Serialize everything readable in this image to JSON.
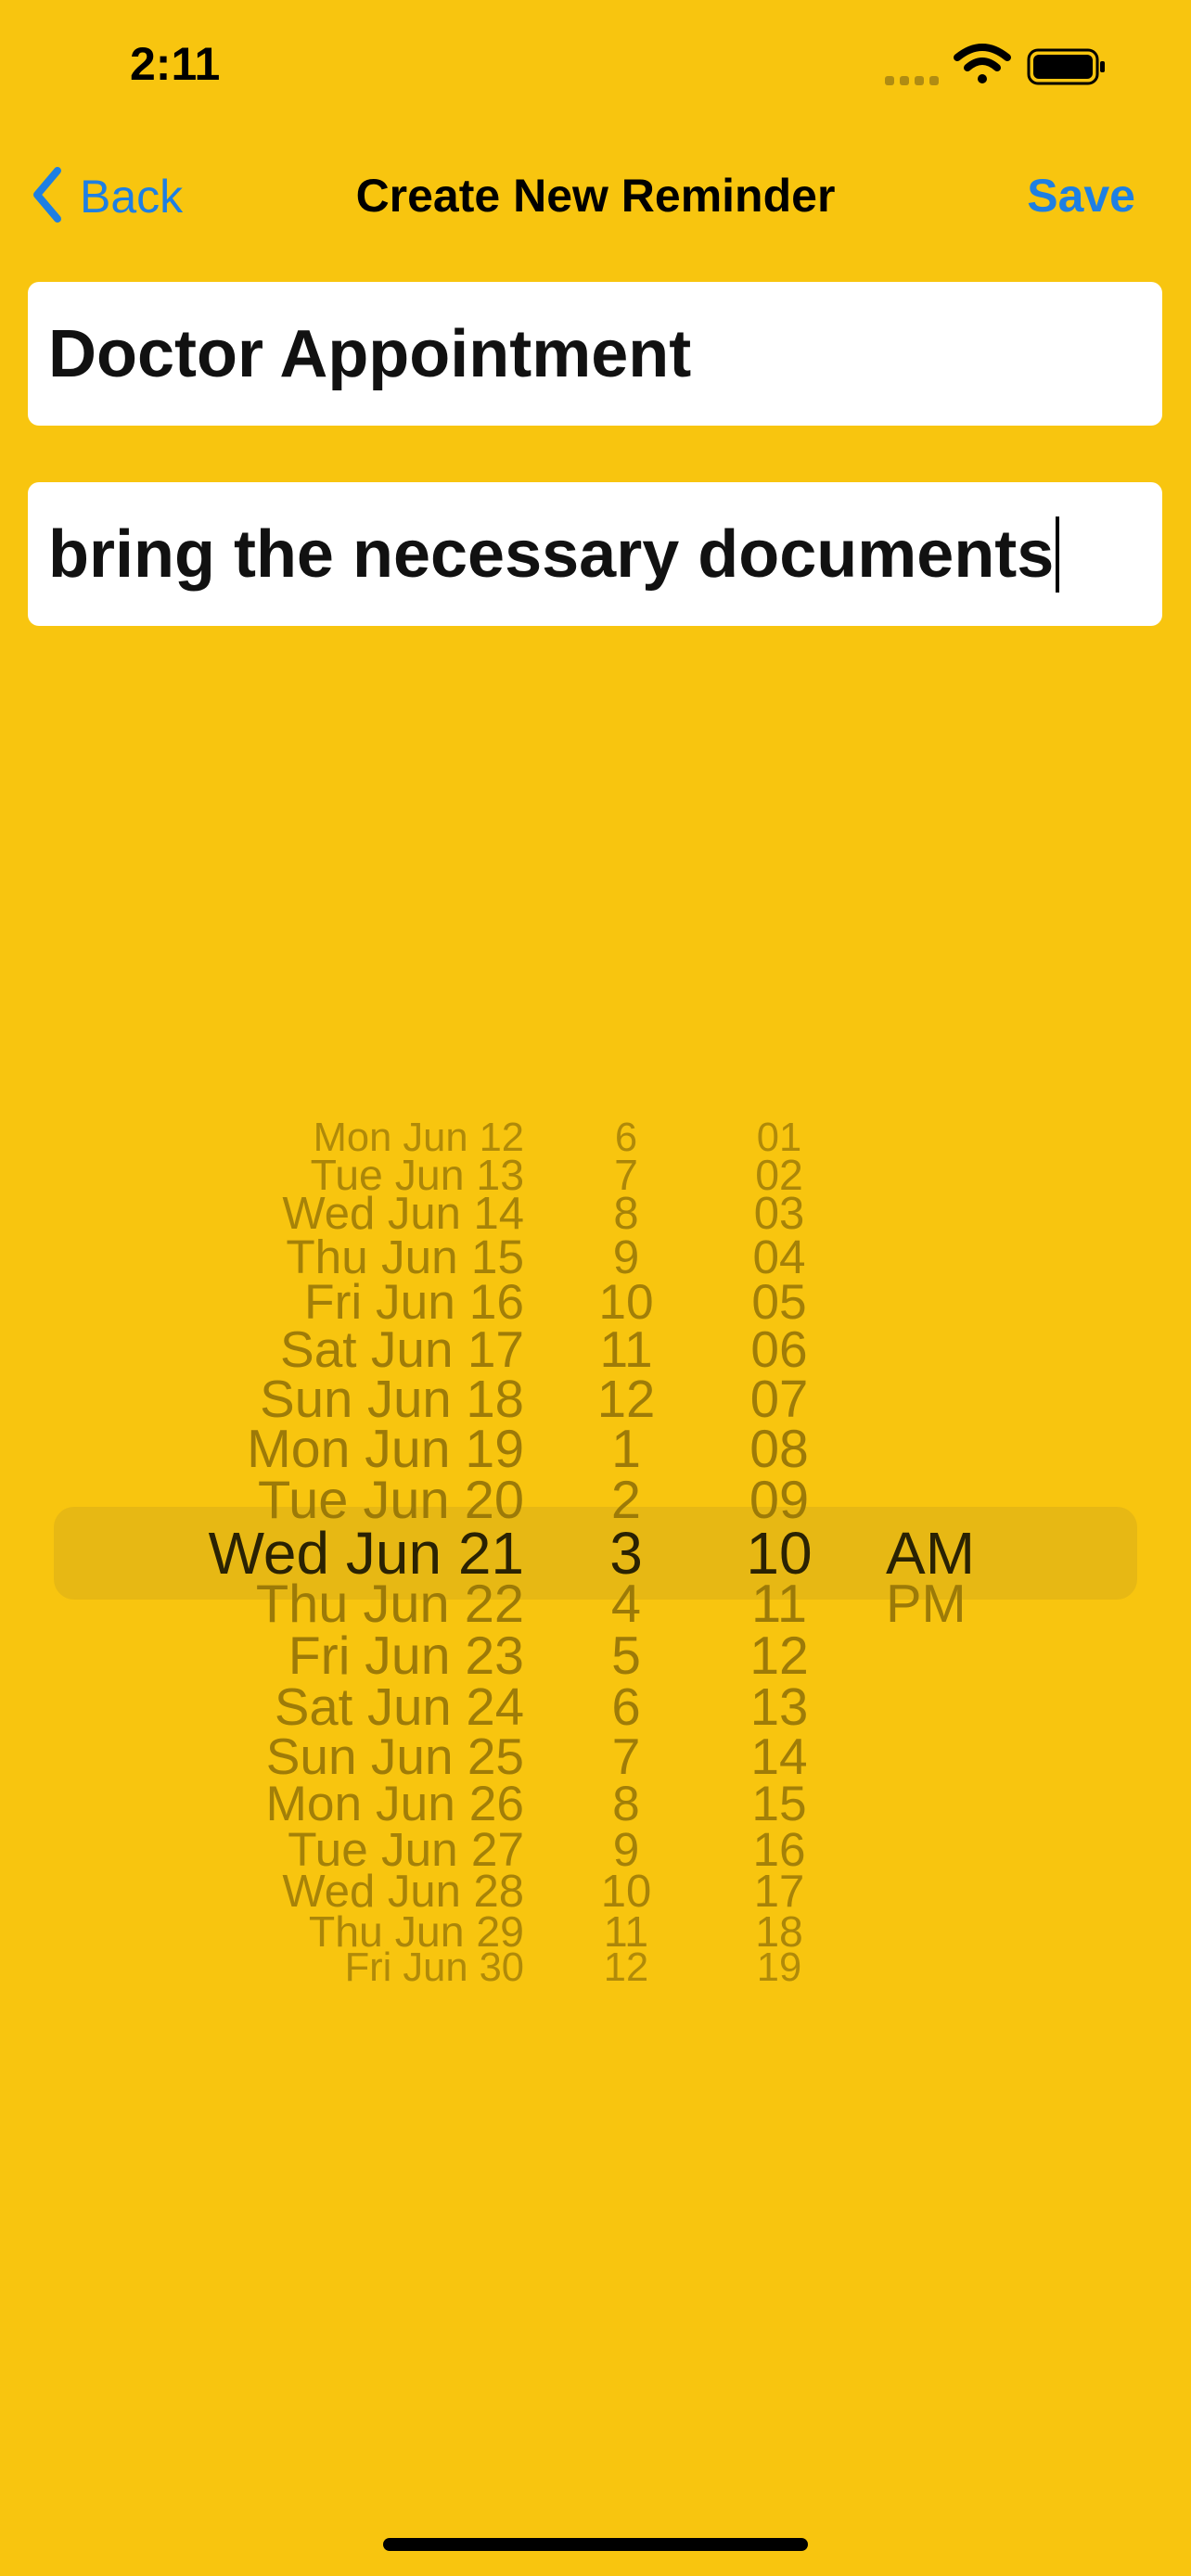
{
  "status": {
    "time": "2:11"
  },
  "nav": {
    "back_label": "Back",
    "title": "Create New Reminder",
    "save_label": "Save"
  },
  "form": {
    "title_value": "Doctor Appointment",
    "notes_value": "bring the necessary documents"
  },
  "picker": {
    "dates": [
      "Mon Jun 12",
      "Tue Jun 13",
      "Wed Jun 14",
      "Thu Jun 15",
      "Fri Jun 16",
      "Sat Jun 17",
      "Sun Jun 18",
      "Mon Jun 19",
      "Tue Jun 20",
      "Wed Jun 21",
      "Thu Jun 22",
      "Fri Jun 23",
      "Sat Jun 24",
      "Sun Jun 25",
      "Mon Jun 26",
      "Tue Jun 27",
      "Wed Jun 28",
      "Thu Jun 29",
      "Fri Jun 30"
    ],
    "hours": [
      "6",
      "7",
      "8",
      "9",
      "10",
      "11",
      "12",
      "1",
      "2",
      "3",
      "4",
      "5",
      "6",
      "7",
      "8",
      "9",
      "10",
      "11",
      "12"
    ],
    "minutes": [
      "01",
      "02",
      "03",
      "04",
      "05",
      "06",
      "07",
      "08",
      "09",
      "10",
      "11",
      "12",
      "13",
      "14",
      "15",
      "16",
      "17",
      "18",
      "19"
    ],
    "periods": [
      "",
      "",
      "",
      "",
      "",
      "",
      "",
      "",
      "",
      "AM",
      "PM",
      "",
      "",
      "",
      "",
      "",
      "",
      "",
      ""
    ],
    "selected_index": 9,
    "selected": {
      "date": "Wed Jun 21",
      "hour": "3",
      "minute": "10",
      "period": "AM"
    }
  },
  "colors": {
    "background": "#F8C50F",
    "accent": "#1E7FE3",
    "picker_text": "#9C7A08",
    "picker_selected_text": "#2A2203"
  }
}
